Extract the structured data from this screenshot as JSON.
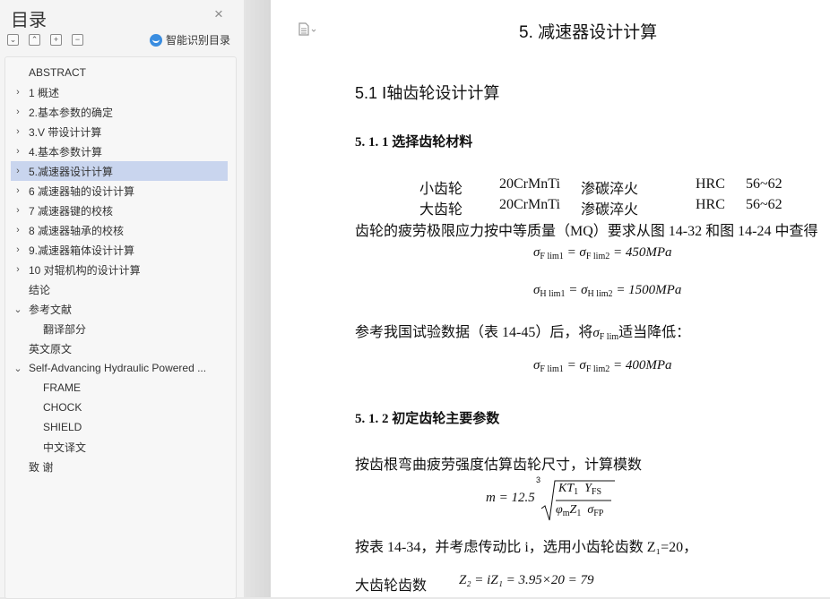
{
  "sidebar": {
    "title": "目录",
    "close_glyph": "×",
    "ai_label": "智能识别目录",
    "tools": [
      "⌄",
      "⌃",
      "+",
      "−"
    ],
    "items": [
      {
        "label": "ABSTRACT",
        "chevron": ""
      },
      {
        "label": "1  概述",
        "chevron": "›"
      },
      {
        "label": "2.基本参数的确定",
        "chevron": "›"
      },
      {
        "label": "3.V 带设计计算",
        "chevron": "›"
      },
      {
        "label": "4.基本参数计算",
        "chevron": "›"
      },
      {
        "label": "5.减速器设计计算",
        "chevron": "›"
      },
      {
        "label": "6  减速器轴的设计计算",
        "chevron": "›"
      },
      {
        "label": "7  减速器键的校核",
        "chevron": "›"
      },
      {
        "label": "8  减速器轴承的校核",
        "chevron": "›"
      },
      {
        "label": "9.减速器箱体设计计算",
        "chevron": "›"
      },
      {
        "label": "10  对辊机构的设计计算",
        "chevron": "›"
      },
      {
        "label": "结论",
        "chevron": ""
      },
      {
        "label": "参考文献",
        "chevron": "⌄"
      },
      {
        "label": "翻译部分",
        "chevron": ""
      },
      {
        "label": "英文原文",
        "chevron": ""
      },
      {
        "label": "Self-Advancing Hydraulic Powered  ...",
        "chevron": "⌄"
      },
      {
        "label": "FRAME",
        "chevron": ""
      },
      {
        "label": "CHOCK",
        "chevron": ""
      },
      {
        "label": "SHIELD",
        "chevron": ""
      },
      {
        "label": "中文译文",
        "chevron": ""
      },
      {
        "label": "致      谢",
        "chevron": ""
      }
    ]
  },
  "doc": {
    "chapter_title": "5. 减速器设计计算",
    "section_title": "5.1  Ⅰ轴齿轮设计计算",
    "sub1_title": "5. 1. 1 选择齿轮材料",
    "materials": [
      {
        "name": "小齿轮",
        "steel": "20CrMnTi",
        "treat": "渗碳淬火",
        "hard": "HRC",
        "range": "56~62"
      },
      {
        "name": "大齿轮",
        "steel": "20CrMnTi",
        "treat": "渗碳淬火",
        "hard": "HRC",
        "range": "56~62"
      }
    ],
    "para1": "齿轮的疲劳极限应力按中等质量（MQ）要求从图 14-32 和图 14-24 中查得",
    "eq1_value": " = 450MPa",
    "eq2_value": " = 1500MPa",
    "para2_a": "参考我国试验数据（表 14-45）后，将",
    "para2_b": "适当降低：",
    "eq3_value": " = 400MPa",
    "sub2_title": "5. 1. 2 初定齿轮主要参数",
    "para3": "按齿根弯曲疲劳强度估算齿轮尺寸，计算模数",
    "eq4_lhs": "m = 12.5",
    "eq4_root": "3",
    "para4": "按表 14-34，并考虑传动比 i，选用小齿轮齿数 Z₁=20，",
    "para5_label": "大齿轮齿数",
    "eq5": "Z₂ = iZ₁ = 3.95×20 = 79"
  }
}
